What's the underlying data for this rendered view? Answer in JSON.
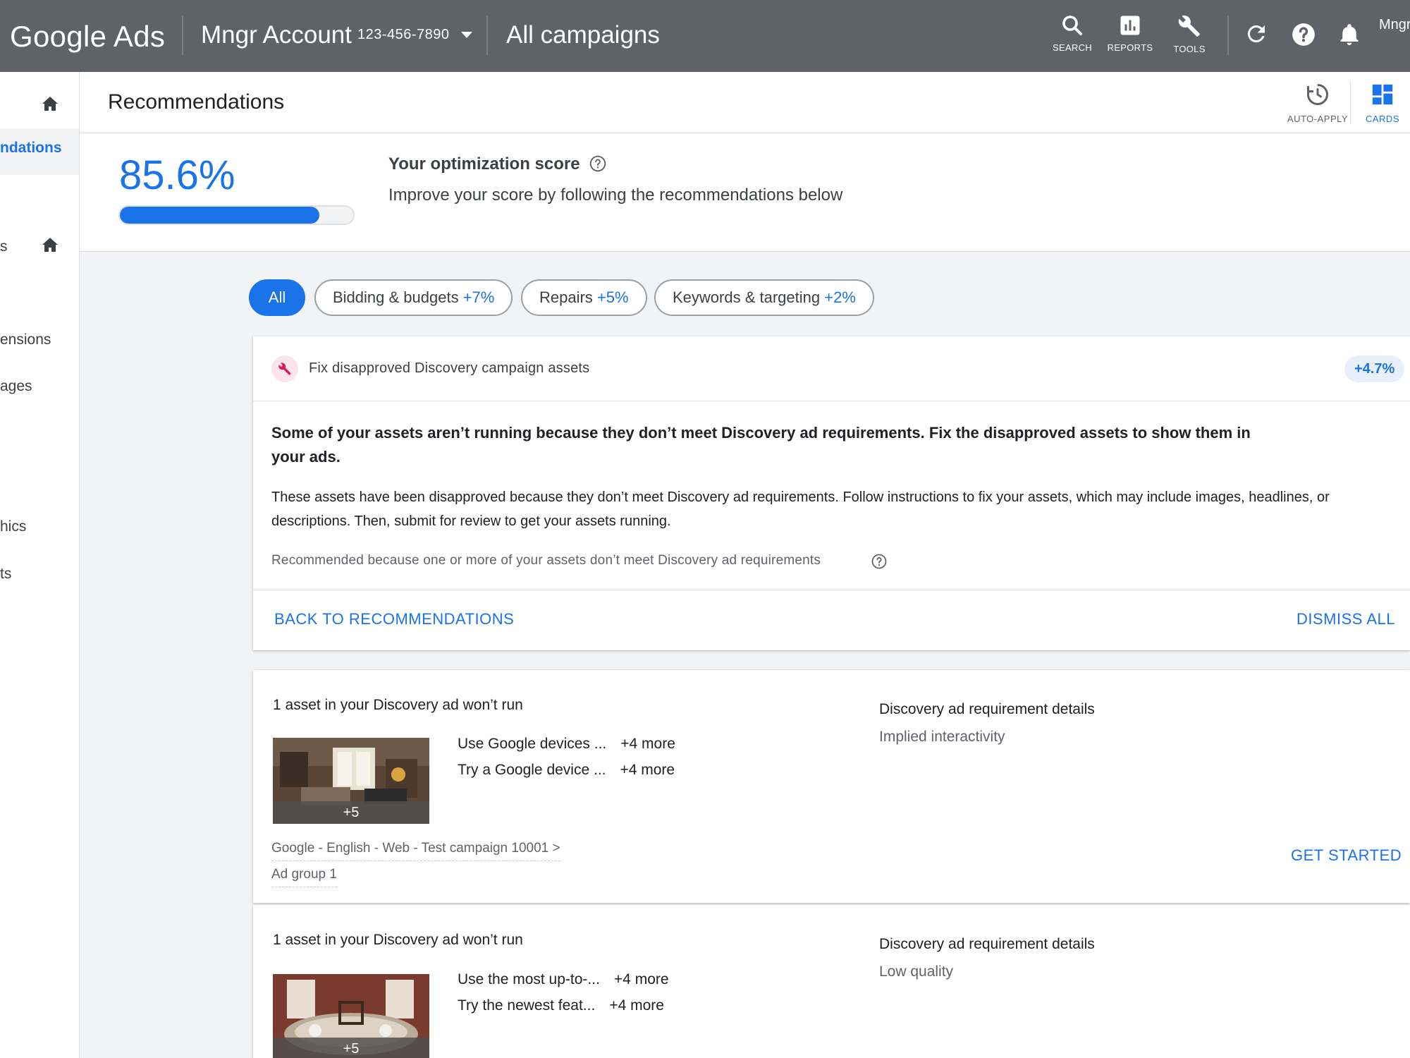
{
  "topbar": {
    "logo": "Google Ads",
    "account_name": "Mngr Account",
    "account_id": "123-456-7890",
    "campaign_scope": "All campaigns",
    "tools": [
      {
        "label": "SEARCH",
        "icon": "search-icon"
      },
      {
        "label": "REPORTS",
        "icon": "reports-icon"
      },
      {
        "label": "TOOLS",
        "icon": "wrench-icon"
      }
    ],
    "user": "Mngr"
  },
  "leftnav": {
    "items": [
      {
        "label": "ndations",
        "active": true
      },
      {
        "label": "s"
      },
      {
        "label": "ensions"
      },
      {
        "label": "ages"
      },
      {
        "label": "hics"
      },
      {
        "label": "ts"
      }
    ]
  },
  "header": {
    "title": "Recommendations",
    "auto_apply_label": "AUTO-APPLY",
    "cards_label": "CARDS"
  },
  "score": {
    "value_text": "85.6%",
    "value": 85.6,
    "heading": "Your optimization score",
    "subtitle": "Improve your score by following the recommendations below"
  },
  "filters": [
    {
      "label": "All",
      "delta": "",
      "active": true
    },
    {
      "label": "Bidding & budgets",
      "delta": "+7%"
    },
    {
      "label": "Repairs",
      "delta": "+5%"
    },
    {
      "label": "Keywords & targeting",
      "delta": "+2%"
    }
  ],
  "recommendation": {
    "title": "Fix disapproved Discovery campaign assets",
    "delta": "+4.7%",
    "summary": "Some of your assets aren’t running because they don’t meet Discovery ad requirements. Fix the disapproved assets to show them in your ads.",
    "description": "These assets have been disapproved because they don’t meet Discovery ad requirements. Follow instructions to fix your assets, which may include images, headlines, or descriptions. Then, submit for review to get your assets running.",
    "reason": "Recommended because one or more of your assets don’t meet Discovery ad requirements",
    "back_label": "BACK TO RECOMMENDATIONS",
    "dismiss_label": "DISMISS ALL"
  },
  "assets": [
    {
      "title": "1 asset in your Discovery ad won’t run",
      "image_more": "+5",
      "headlines": [
        {
          "text": "Use Google devices ...",
          "more": "+4 more"
        },
        {
          "text": "Try a Google device ...",
          "more": "+4 more"
        }
      ],
      "campaign": "Google - English - Web - Test campaign 10001 >",
      "ad_group": "Ad group 1",
      "requirement_title": "Discovery ad requirement details",
      "requirement": "Implied interactivity",
      "action_label": "GET STARTED"
    },
    {
      "title": "1 asset in your Discovery ad won’t run",
      "image_more": "+5",
      "headlines": [
        {
          "text": "Use the most up-to-...",
          "more": "+4 more"
        },
        {
          "text": "Try the newest feat...",
          "more": "+4 more"
        }
      ],
      "requirement_title": "Discovery ad requirement details",
      "requirement": "Low quality"
    }
  ],
  "colors": {
    "topbar": "#5f6368",
    "accent": "#1a73e8",
    "background": "#f1f3f4"
  }
}
